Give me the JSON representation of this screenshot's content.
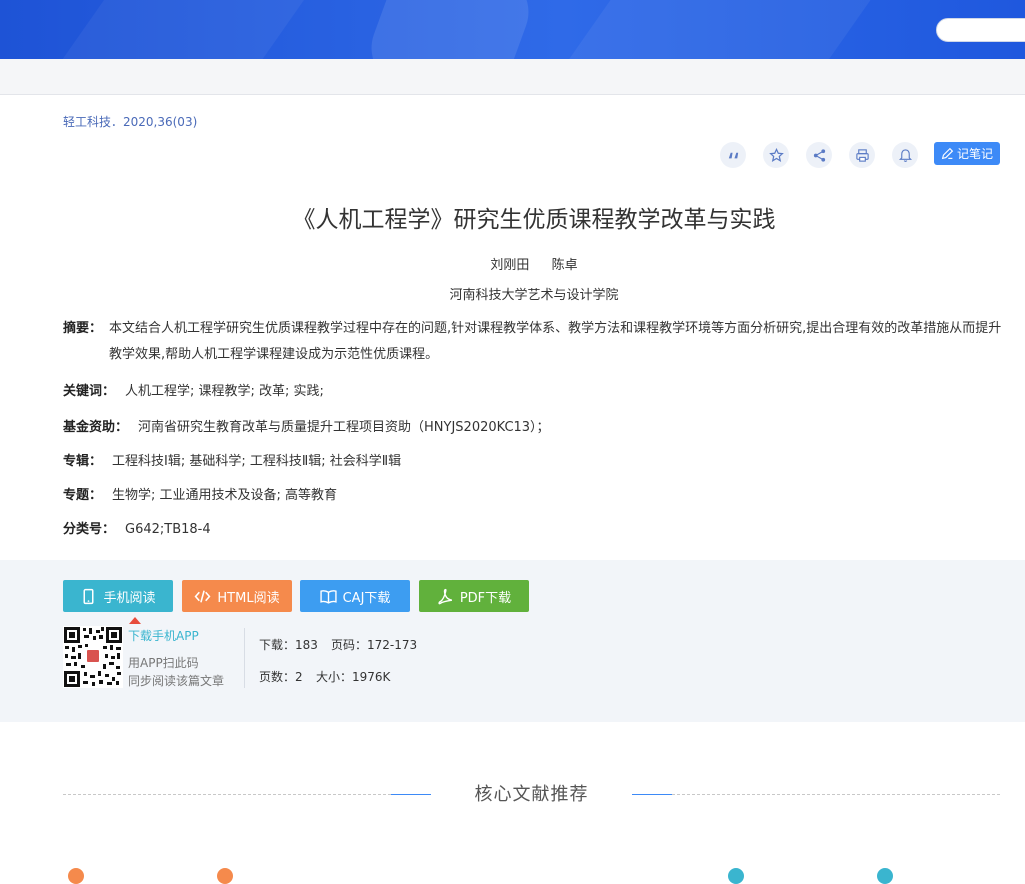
{
  "journal": "轻工科技．2020,36(03)",
  "tools": {
    "note_label": "记笔记"
  },
  "paper": {
    "title": "《人机工程学》研究生优质课程教学改革与实践",
    "authors": [
      "刘刚田",
      "陈卓"
    ],
    "affiliation": "河南科技大学艺术与设计学院",
    "abstract_label": "摘要：",
    "abstract": "本文结合人机工程学研究生优质课程教学过程中存在的问题,针对课程教学体系、教学方法和课程教学环境等方面分析研究,提出合理有效的改革措施从而提升教学效果,帮助人机工程学课程建设成为示范性优质课程。",
    "keywords_label": "关键词：",
    "keywords": "人机工程学;  课程教学;  改革;  实践;",
    "fund_label": "基金资助：",
    "fund": "河南省研究生教育改革与质量提升工程项目资助（HNYJS2020KC13）；",
    "series_label": "专辑：",
    "series": "工程科技Ⅰ辑; 基础科学; 工程科技Ⅱ辑; 社会科学Ⅱ辑",
    "topic_label": "专题：",
    "topic": "生物学; 工业通用技术及设备; 高等教育",
    "class_label": "分类号：",
    "class": "G642;TB18-4"
  },
  "download": {
    "mobile_label": "手机阅读",
    "html_label": "HTML阅读",
    "caj_label": "CAJ下载",
    "pdf_label": "PDF下载",
    "app_link": "下载手机APP",
    "app_tip1": "用APP扫此码",
    "app_tip2": "同步阅读该篇文章",
    "downloads_label": "下载：",
    "downloads": "183",
    "pages_label": "页码：",
    "pages": "172-173",
    "pagecount_label": "页数：",
    "pagecount": "2",
    "size_label": "大小：",
    "size": "1976K"
  },
  "recommend": {
    "title": "核心文献推荐"
  },
  "colors": {
    "accent": "#3d8af7",
    "mobile": "#3ab5cf",
    "html": "#f58a4c",
    "caj": "#3d9df1",
    "pdf": "#61b13c"
  }
}
